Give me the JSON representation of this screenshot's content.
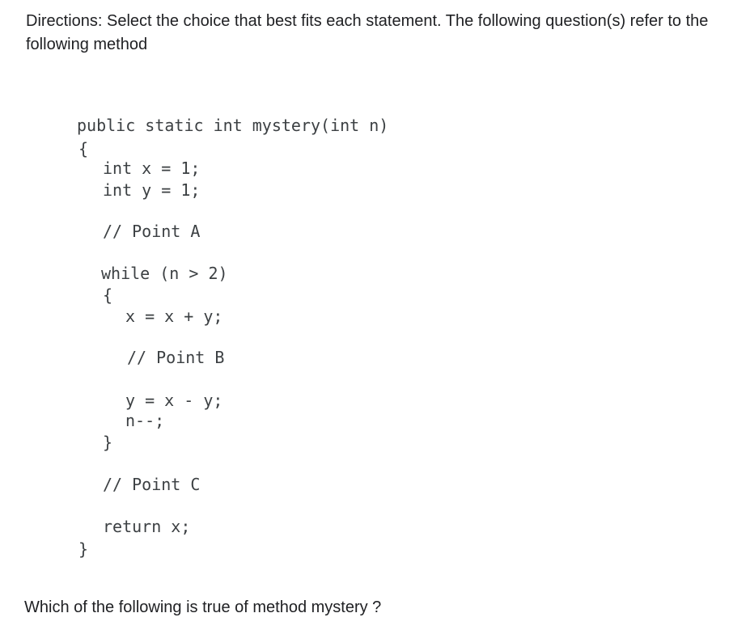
{
  "directions": "Directions: Select the choice that best fits each statement. The following question(s) refer to the following method",
  "code": {
    "line_signature": "public static int mystery(int n)",
    "line_open_brace": "{",
    "line_int_x": "int x = 1;",
    "line_int_y": "int y = 1;",
    "comment_point_a": "// Point A",
    "line_while": "while (n > 2)",
    "line_while_open": "{",
    "line_x_assign": "x = x + y;",
    "comment_point_b": "// Point B",
    "line_y_assign": "y = x - y;",
    "line_decrement": "n--;",
    "line_while_close": "}",
    "comment_point_c": "// Point C",
    "line_return": "return x;",
    "line_close_brace": "}"
  },
  "question": "Which of the following is true of method mystery ?"
}
